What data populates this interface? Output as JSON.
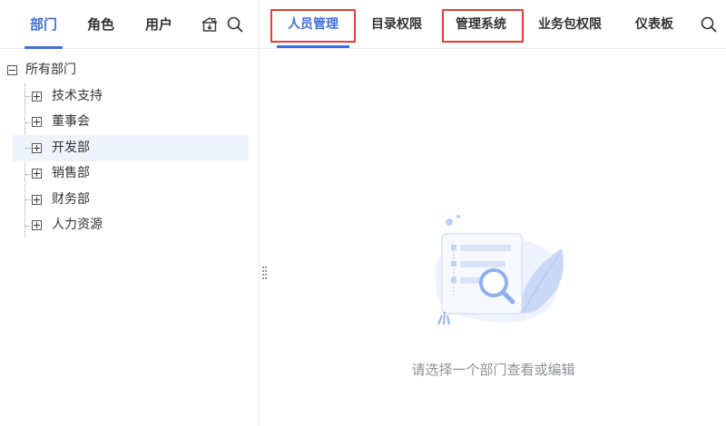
{
  "left_tabs": [
    {
      "label": "部门",
      "active": true
    },
    {
      "label": "角色",
      "active": false
    },
    {
      "label": "用户",
      "active": false
    }
  ],
  "left_icons": [
    "sync-department-icon",
    "search-icon"
  ],
  "tree": {
    "root": "所有部门",
    "children": [
      "技术支持",
      "董事会",
      "开发部",
      "销售部",
      "财务部",
      "人力资源"
    ],
    "selected": "开发部"
  },
  "right_tabs": [
    {
      "label": "人员管理",
      "active": true,
      "highlighted": true
    },
    {
      "label": "目录权限",
      "active": false,
      "highlighted": false
    },
    {
      "label": "管理系统",
      "active": false,
      "highlighted": true
    },
    {
      "label": "业务包权限",
      "active": false,
      "highlighted": false
    },
    {
      "label": "仪表板",
      "active": false,
      "highlighted": false
    }
  ],
  "empty_state": {
    "message": "请选择一个部门查看或编辑",
    "icon": "document-search-icon"
  },
  "colors": {
    "accent": "#3d6fdb",
    "highlight_box": "#e0403a",
    "selected_row": "#eef3fc"
  }
}
